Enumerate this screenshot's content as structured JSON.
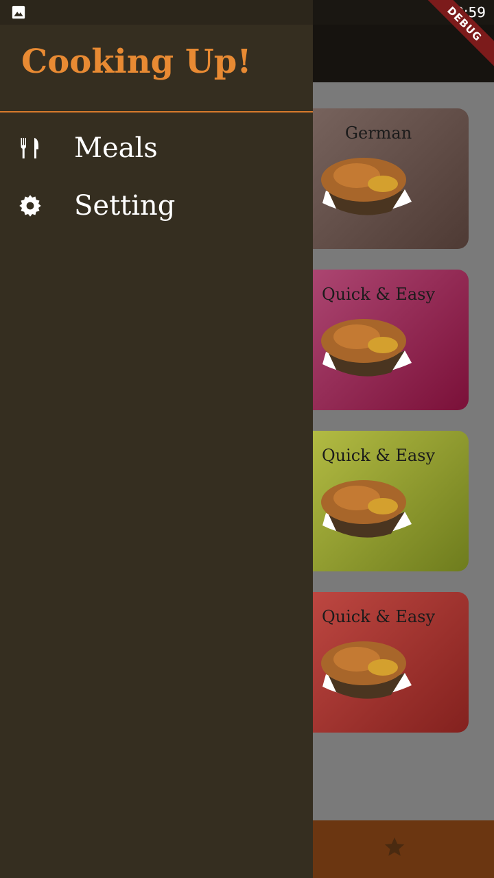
{
  "status_bar": {
    "time": "8:59",
    "notification_icon": "image-icon"
  },
  "debug_banner": "DEBUG",
  "drawer": {
    "title": "Cooking Up!",
    "items": [
      {
        "label": "Meals",
        "icon": "restaurant-icon"
      },
      {
        "label": "Setting",
        "icon": "gear-icon"
      }
    ]
  },
  "categories": [
    {
      "title": "German",
      "color_start": "#7a6660",
      "color_end": "#4e3a34"
    },
    {
      "title": "Quick & Easy",
      "color_start": "#b04a76",
      "color_end": "#7a1038"
    },
    {
      "title": "Quick & Easy",
      "color_start": "#b8c046",
      "color_end": "#6e7c1d"
    },
    {
      "title": "Quick & Easy",
      "color_start": "#c24a44",
      "color_end": "#83211e"
    }
  ],
  "bottom_nav": {
    "icon": "star-icon"
  },
  "colors": {
    "drawer_bg": "#352e20",
    "accent": "#e88a33",
    "scrim": "#7a7a7a",
    "bottom_bar": "#6b3611"
  }
}
